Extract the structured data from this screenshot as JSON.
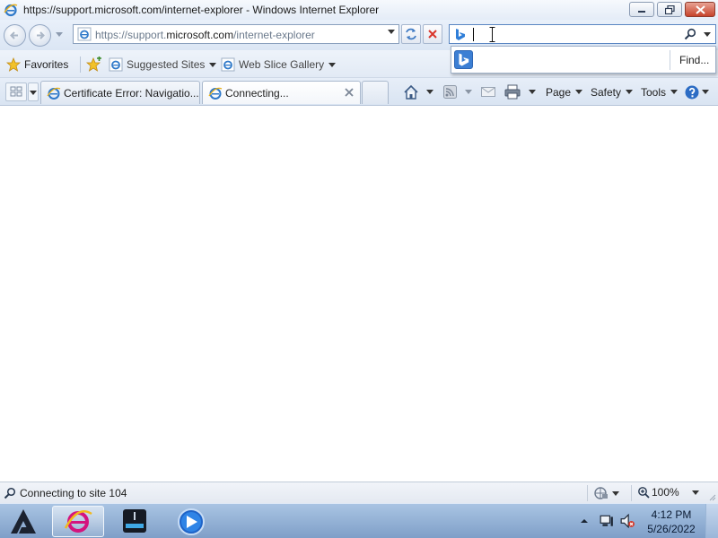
{
  "window": {
    "title": "https://support.microsoft.com/internet-explorer - Windows Internet Explorer",
    "app_icon": "ie-icon"
  },
  "address_bar": {
    "url_prefix": "https://support.",
    "url_domain": "microsoft.com",
    "url_suffix": "/internet-explorer",
    "page_icon": "ie-page-icon"
  },
  "search": {
    "value": "",
    "provider_icon": "bing-icon",
    "find_label": "Find..."
  },
  "favorites_bar": {
    "favorites_label": "Favorites",
    "suggested_sites_label": "Suggested Sites",
    "web_slice_gallery_label": "Web Slice Gallery"
  },
  "tabs": [
    {
      "label": "Certificate Error: Navigatio...",
      "state": "inactive",
      "icon": "ie-page-icon"
    },
    {
      "label": "Connecting...",
      "state": "active",
      "icon": "ie-page-icon"
    }
  ],
  "command_bar": {
    "page_label": "Page",
    "safety_label": "Safety",
    "tools_label": "Tools"
  },
  "status_bar": {
    "text": "Connecting to site 104",
    "zoom": "100%"
  },
  "taskbar": {
    "time": "4:12 PM",
    "date": "5/26/2022"
  },
  "colors": {
    "accent": "#3c7fd4",
    "chrome": "#dbe6f4",
    "taskbar": "#7f9fc8",
    "close_button": "#c7432b"
  }
}
